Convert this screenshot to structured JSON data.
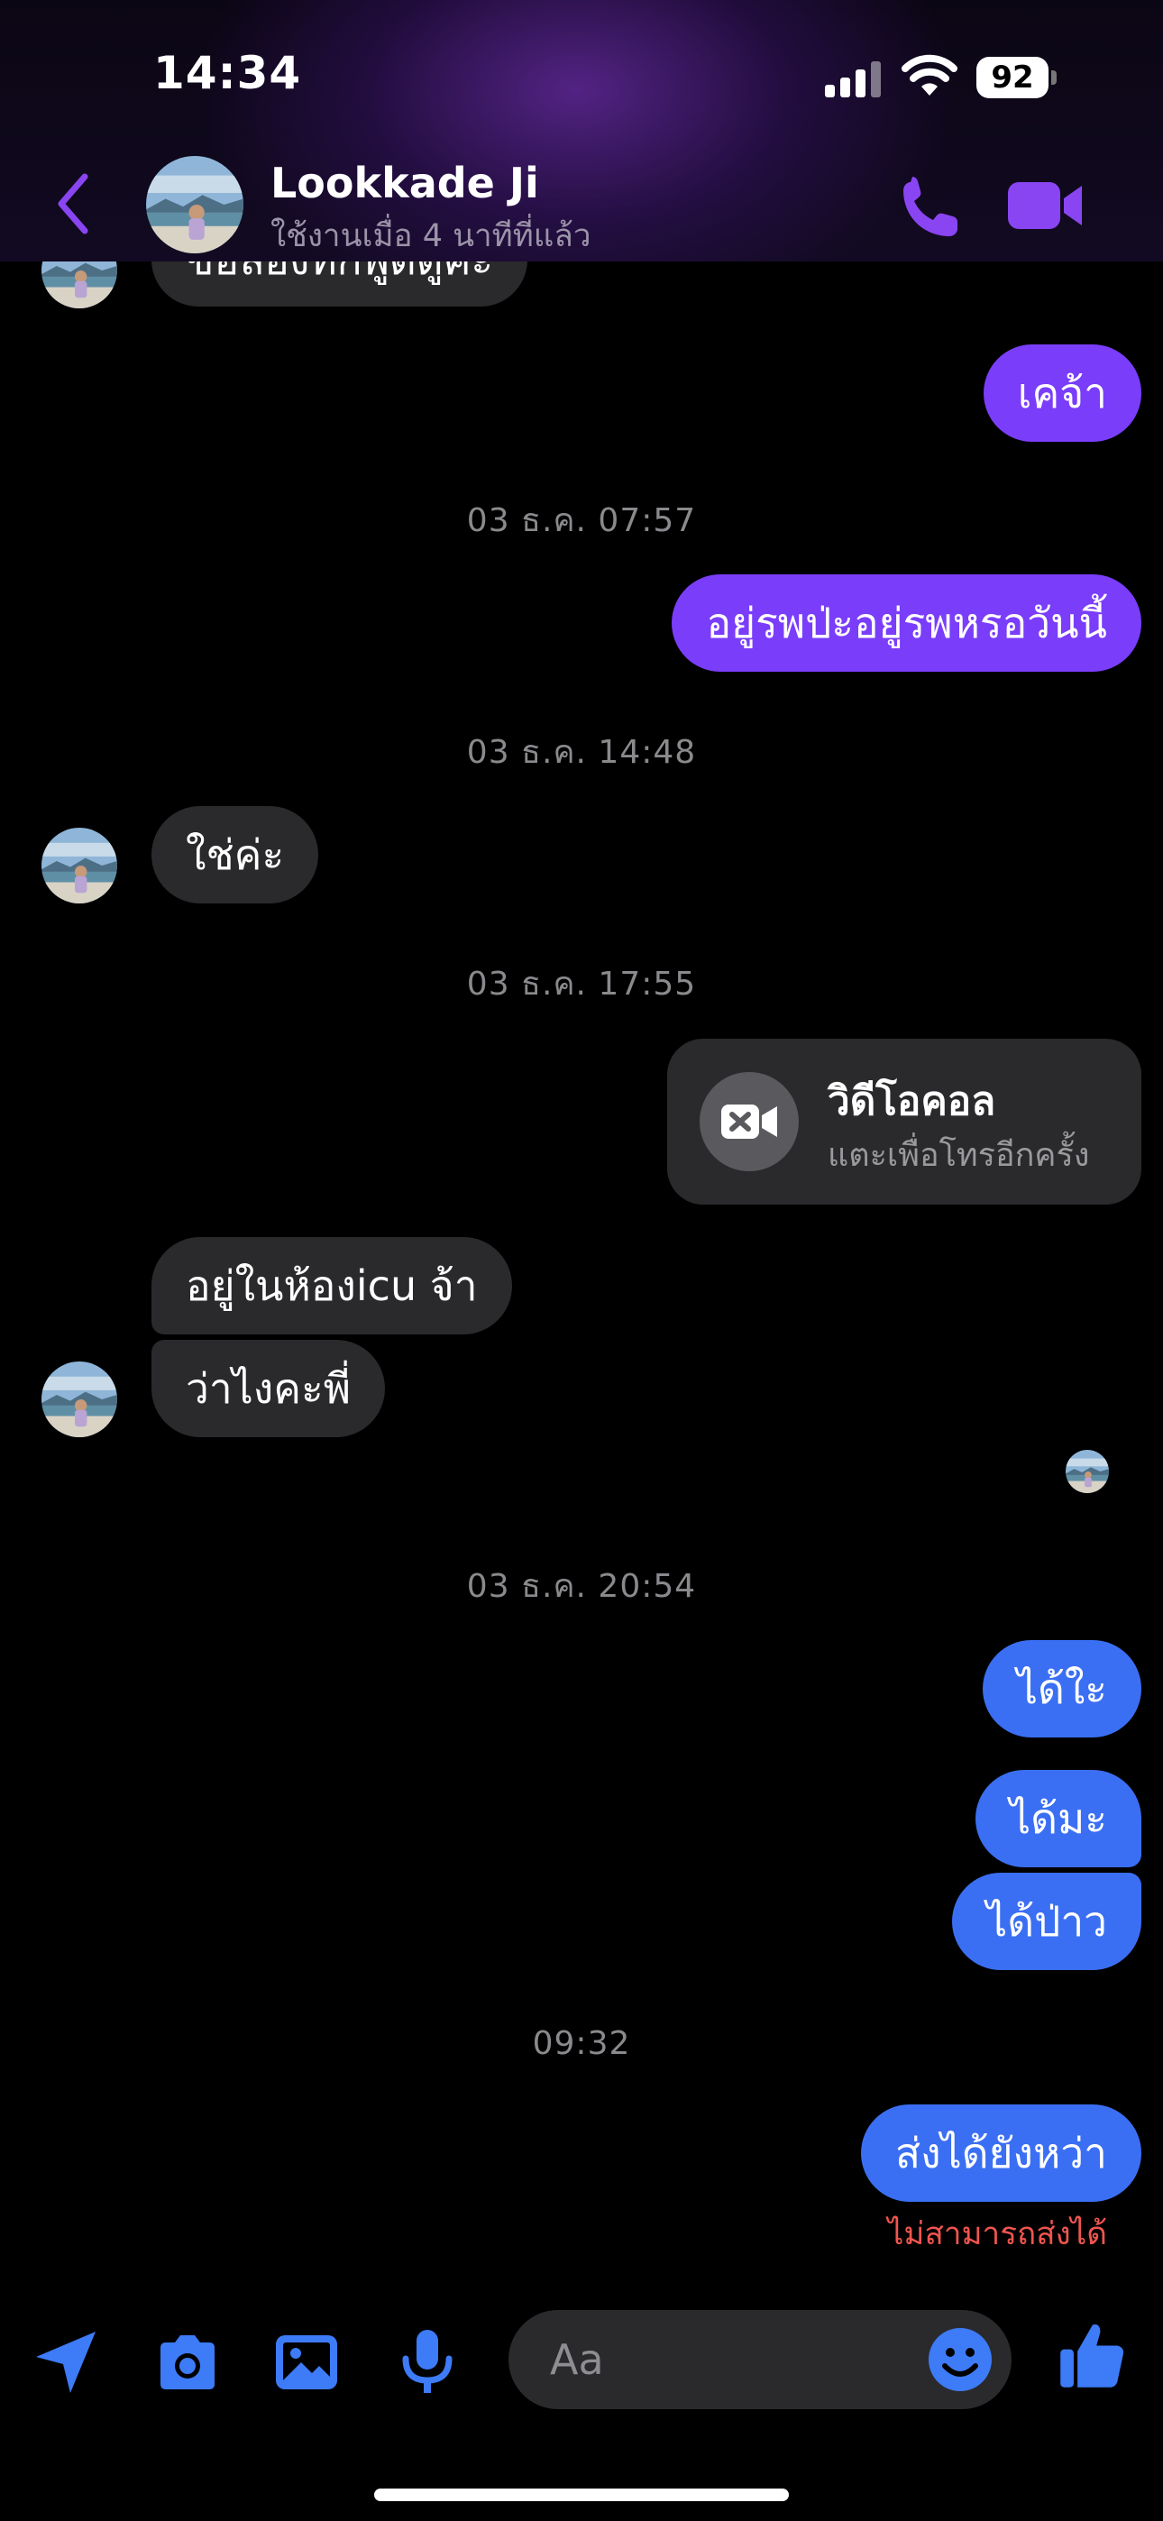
{
  "status_bar": {
    "time": "14:34",
    "battery": "92"
  },
  "header": {
    "contact_name": "Lookkade Ji",
    "last_active": "ใช้งานเมื่อ 4 นาทีที่แล้ว"
  },
  "messages": {
    "partial_top": "ขอลองทักพูดดูค่ะ",
    "m1": "เคจ้า",
    "t1": "03 ธ.ค. 07:57",
    "m2": "อยู่รพป่ะอยู่รพหรอวันนี้",
    "t2": "03 ธ.ค. 14:48",
    "m3": "ใช่ค่ะ",
    "t3": "03 ธ.ค. 17:55",
    "call_title": "วิดีโอคอล",
    "call_subtitle": "แตะเพื่อโทรอีกครั้ง",
    "m4": "อยู่ในห้องicu จ้า",
    "m5": "ว่าไงคะพี่",
    "t4": "03 ธ.ค. 20:54",
    "m6": "ได้ใะ",
    "m7": "ได้มะ",
    "m8": "ได้ป่าว",
    "t5": "09:32",
    "m9": "ส่งได้ยังหว่า",
    "failed": "ไม่สามารถส่งได้"
  },
  "composer": {
    "placeholder": "Aa"
  },
  "colors": {
    "accent_purple": "#7a3dfa",
    "outgoing_blue": "#3b6ff3",
    "incoming_gray": "#2a2a2c",
    "error_red": "#f0554f"
  },
  "icons": {
    "header": [
      "back-chevron-icon",
      "phone-icon",
      "video-camera-icon"
    ],
    "composer": [
      "location-arrow-icon",
      "camera-icon",
      "photo-icon",
      "microphone-icon",
      "emoji-icon",
      "thumbs-up-icon"
    ]
  }
}
